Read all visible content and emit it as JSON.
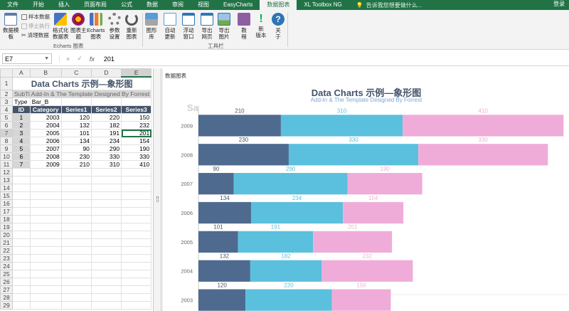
{
  "menu": {
    "items": [
      "文件",
      "开始",
      "插入",
      "页面布局",
      "公式",
      "数据",
      "审阅",
      "视图",
      "EasyCharts",
      "数据图表",
      "XL Toolbox NG"
    ],
    "active_index": 9,
    "tell_me": "告诉我您想要做什么...",
    "login": "登录"
  },
  "ribbon": {
    "template_button": "数据模\n板",
    "sample_data": "样本数据",
    "stop_exec": "停止执行",
    "clear_data": "清理数据",
    "format_data": "格式化\n数据表",
    "chart_theme": "图表主\n题",
    "echarts_chart": "Echarts\n图表",
    "param_settings": "参数\n设置",
    "redraw": "重新\n图表",
    "echarts_group": "Echarts 图表",
    "chart_lib": "图形\n库",
    "auto_update": "自动\n更新",
    "float_window": "浮动\n窗口",
    "export_web": "导出\n网页",
    "export_image": "导出\n图片",
    "tutorial": "教\n程",
    "new_version": "新\n版本",
    "about": "关\n于",
    "toolbar_group": "工具栏"
  },
  "formula_bar": {
    "name_box": "E7",
    "cancel": "×",
    "enter": "✓",
    "fx": "fx",
    "value": "201"
  },
  "sheet": {
    "columns": [
      "A",
      "B",
      "C",
      "D",
      "E"
    ],
    "selected_column": "E",
    "selected_row": 7,
    "title": "Data Charts 示例—象形图",
    "subtitle_row": "SubTi Add-In & The Template Designed By Forrest",
    "type_label": "Type",
    "type_value": "Bar_B",
    "headers": [
      "ID",
      "Category",
      "Series1",
      "Series2",
      "Series3"
    ],
    "rows": [
      [
        1,
        2003,
        120,
        220,
        150
      ],
      [
        2,
        2004,
        132,
        182,
        232
      ],
      [
        3,
        2005,
        101,
        191,
        201
      ],
      [
        4,
        2006,
        134,
        234,
        154
      ],
      [
        5,
        2007,
        90,
        290,
        190
      ],
      [
        6,
        2008,
        230,
        330,
        330
      ],
      [
        7,
        2009,
        210,
        310,
        410
      ]
    ],
    "row_numbers": [
      1,
      2,
      3,
      4,
      5,
      6,
      7,
      8,
      9,
      10,
      11,
      12,
      13,
      14,
      15,
      16,
      17,
      18,
      19,
      20,
      21,
      22,
      23,
      24,
      25,
      26,
      27,
      28,
      29
    ]
  },
  "panel": {
    "label": "数据图表",
    "ghost_text": "Sa"
  },
  "chart_data": {
    "type": "bar",
    "orientation": "horizontal",
    "stacked": true,
    "title": "Data Charts 示例—象形图",
    "subtitle": "Add-In & The Template Designed By Forrest",
    "categories": [
      "2003",
      "2004",
      "2005",
      "2006",
      "2007",
      "2008",
      "2009"
    ],
    "series": [
      {
        "name": "Series1",
        "values": [
          120,
          132,
          101,
          134,
          90,
          230,
          210
        ],
        "color": "#4f6a8f"
      },
      {
        "name": "Series2",
        "values": [
          220,
          182,
          191,
          234,
          290,
          330,
          310
        ],
        "color": "#5bc0de"
      },
      {
        "name": "Series3",
        "values": [
          150,
          232,
          201,
          154,
          190,
          330,
          410
        ],
        "color": "#f0acd8"
      }
    ],
    "xlim": [
      0,
      1000
    ],
    "grid": false,
    "data_label_colors": [
      "#44546a",
      "#5bc0de",
      "#f0acd8"
    ]
  }
}
